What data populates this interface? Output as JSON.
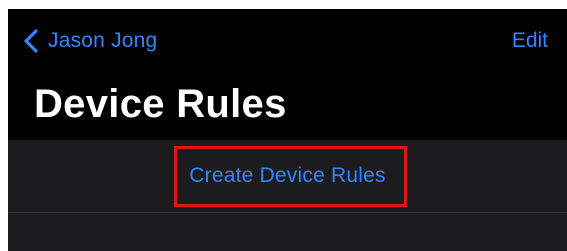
{
  "nav": {
    "back_label": "Jason Jong",
    "back_icon": "chevron-left-icon",
    "edit_label": "Edit"
  },
  "page": {
    "title": "Device Rules"
  },
  "list": {
    "create_label": "Create Device Rules"
  },
  "colors": {
    "background": "#000000",
    "accent": "#2f86ff",
    "group_background": "#1c1c1e",
    "highlight": "#e0141c"
  }
}
